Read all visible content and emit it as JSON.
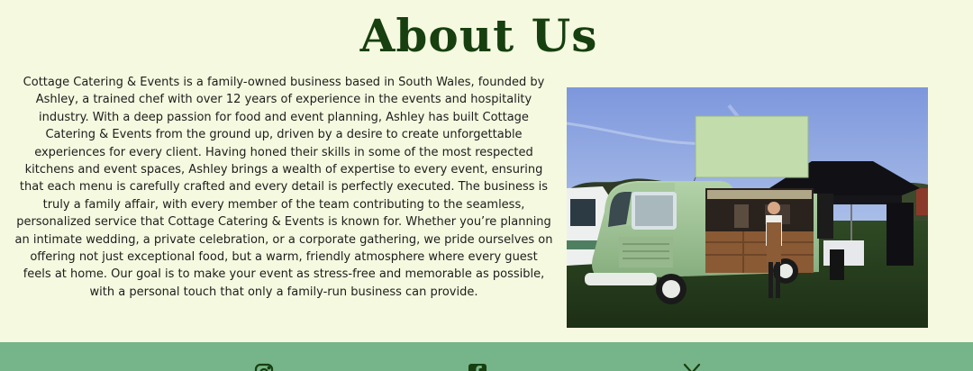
{
  "about": {
    "heading": "About Us",
    "body": "Cottage Catering & Events is a family-owned business based in South Wales, founded by Ashley, a trained chef with over 12 years of experience in the events and hospitality industry. With a deep passion for food and event planning, Ashley has built Cottage Catering & Events from the ground up, driven by a desire to create unforgettable experiences for every client. Having honed their skills in some of the most respected kitchens and event spaces, Ashley brings a wealth of expertise to every event, ensuring that each menu is carefully crafted and every detail is perfectly executed. The business is truly a family affair, with every member of the team contributing to the seamless, personalized service that Cottage Catering & Events is known for. Whether you’re planning an intimate wedding, a private celebration, or a corporate gathering, we pride ourselves on offering not just exceptional food, but a warm, friendly atmosphere where every guest feels at home. Our goal is to make your event as stress-free and memorable as possible, with a personal touch that only a family-run business can provide."
  },
  "footer": {
    "social_icons": [
      "instagram-icon",
      "facebook-icon",
      "x-icon"
    ]
  },
  "colors": {
    "page_background": "#f5f9df",
    "heading": "#173f0f",
    "footer_background": "#76b48a",
    "van_green": "#9ec196"
  }
}
